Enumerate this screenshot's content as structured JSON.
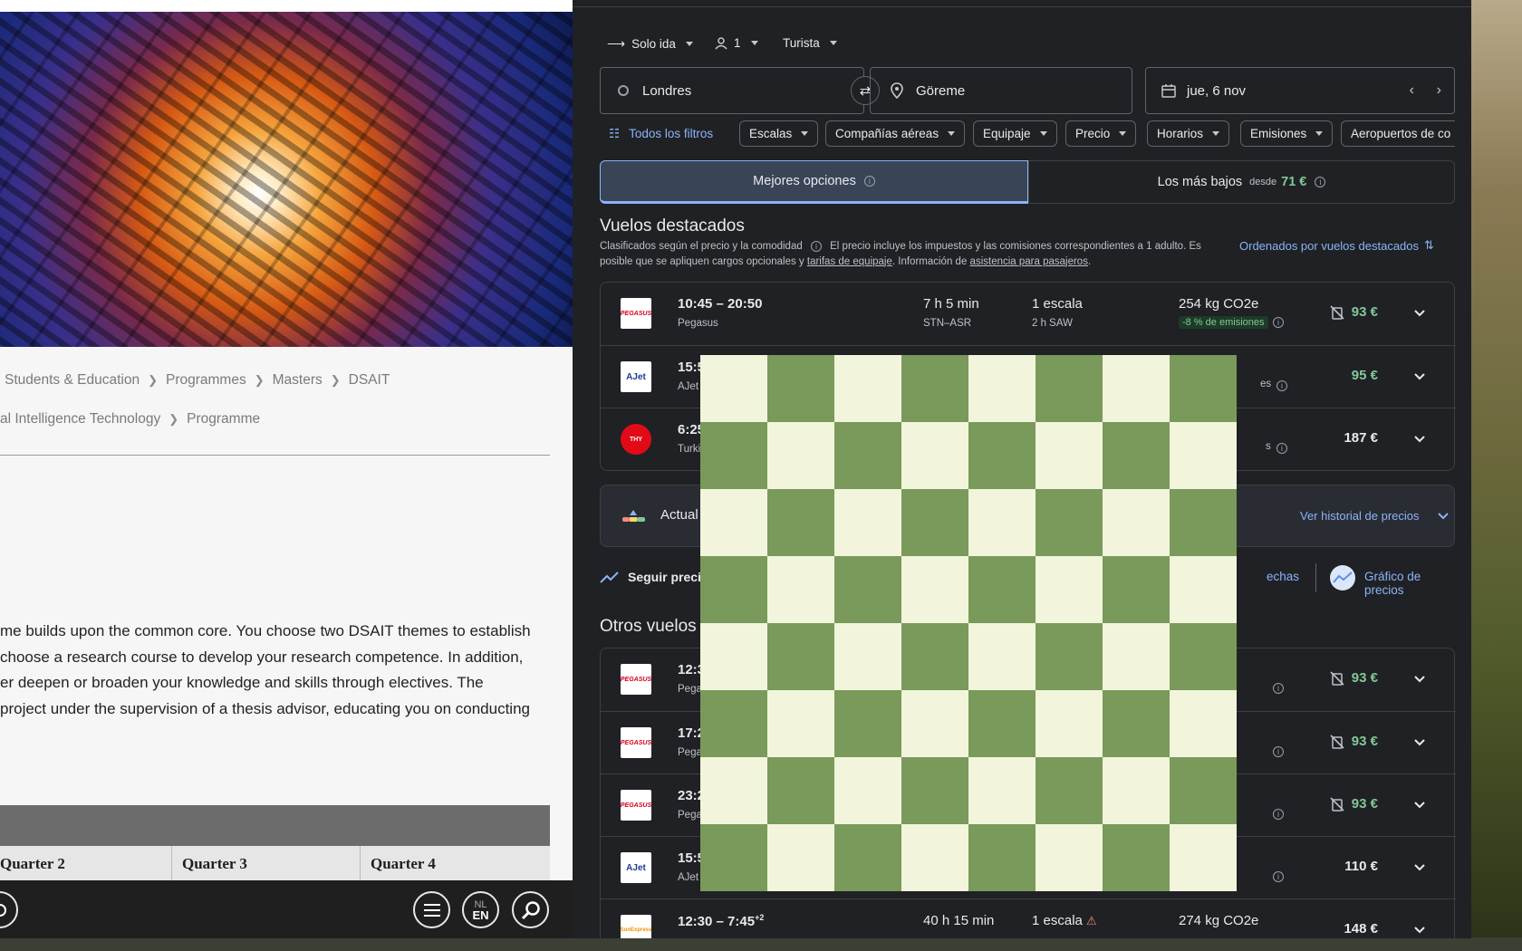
{
  "left_page": {
    "breadcrumb_1": [
      "Students & Education",
      "Programmes",
      "Masters",
      "DSAIT"
    ],
    "breadcrumb_2": [
      "al Intelligence Technology",
      "Programme"
    ],
    "body_lines": [
      "me builds upon the common core. You choose two DSAIT themes to establish",
      "choose a research course to develop your research competence. In addition,",
      "er deepen or broaden your knowledge and skills through electives. The",
      " project under the supervision of a thesis advisor, educating you on conducting"
    ],
    "table_quarters": [
      "Quarter 2",
      "Quarter 3",
      "Quarter 4"
    ],
    "footer": {
      "lang_top": "NL",
      "lang_bottom": "EN"
    }
  },
  "flights": {
    "trip_type": "Solo ida",
    "passengers": "1",
    "cabin": "Turista",
    "origin": "Londres",
    "destination": "Göreme",
    "date": "jue, 6 nov",
    "filters": [
      "Todos los filtros",
      "Escalas",
      "Compañías aéreas",
      "Equipaje",
      "Precio",
      "Horarios",
      "Emisiones",
      "Aeropuertos de co"
    ],
    "tabs": {
      "best": "Mejores opciones",
      "cheapest": "Los más bajos",
      "cheapest_from": "desde",
      "cheapest_price": "71 €"
    },
    "featured_title": "Vuelos destacados",
    "featured_sub_1": "Clasificados según el precio y la comodidad",
    "featured_sub_2": "El precio incluye los impuestos y las comisiones correspondientes a 1 adulto. Es",
    "featured_sub_3": "posible que se apliquen cargos opcionales y",
    "featured_sub_link1": "tarifas de equipaje",
    "featured_sub_4": ". Información de",
    "featured_sub_link2": "asistencia para pasajeros",
    "featured_sub_5": ".",
    "sort_label": "Ordenados por vuelos destacados",
    "featured": [
      {
        "time": "10:45 – 20:50",
        "airline": "Pegasus",
        "duration": "7 h 5 min",
        "route": "STN–ASR",
        "stops": "1 escala",
        "stop_detail": "2 h SAW",
        "co2": "254 kg CO2e",
        "badge": "-8 % de emisiones",
        "price": "93 €",
        "logo": "PEGASUS"
      },
      {
        "time": "15:5",
        "airline": "AJet",
        "tail": "es",
        "price": "95 €",
        "logo": "AJet"
      },
      {
        "time": "6:25",
        "airline": "Turki",
        "tail": "s",
        "price": "187 €",
        "logo": "THY"
      }
    ],
    "price_box": {
      "label": "Actual",
      "history": "Ver historial de precios"
    },
    "track": {
      "label": "Seguir precio",
      "dates": "echas",
      "graph": "Gráfico de precios"
    },
    "others_title": "Otros vuelos",
    "others": [
      {
        "time": "12:3",
        "airline": "Pega",
        "price": "93 €",
        "logo": "PEGASUS"
      },
      {
        "time": "17:2",
        "airline": "Pega",
        "price": "93 €",
        "logo": "PEGASUS"
      },
      {
        "time": "23:2",
        "airline": "Pega",
        "price": "93 €",
        "logo": "PEGASUS"
      },
      {
        "time": "15:5",
        "airline": "AJet",
        "price": "110 €",
        "logo": "AJet"
      },
      {
        "time": "12:30 – 7:45",
        "time_sup": "+2",
        "airline": "",
        "duration": "40 h 15 min",
        "stops": "1 escala",
        "co2": "274 kg CO2e",
        "price": "148 €",
        "logo": "SunExpress"
      }
    ]
  },
  "colors": {
    "accent_blue": "#8ab4f8",
    "price_green": "#81c995",
    "chess_light": "#f2f5dc",
    "chess_dark": "#799a5a"
  }
}
